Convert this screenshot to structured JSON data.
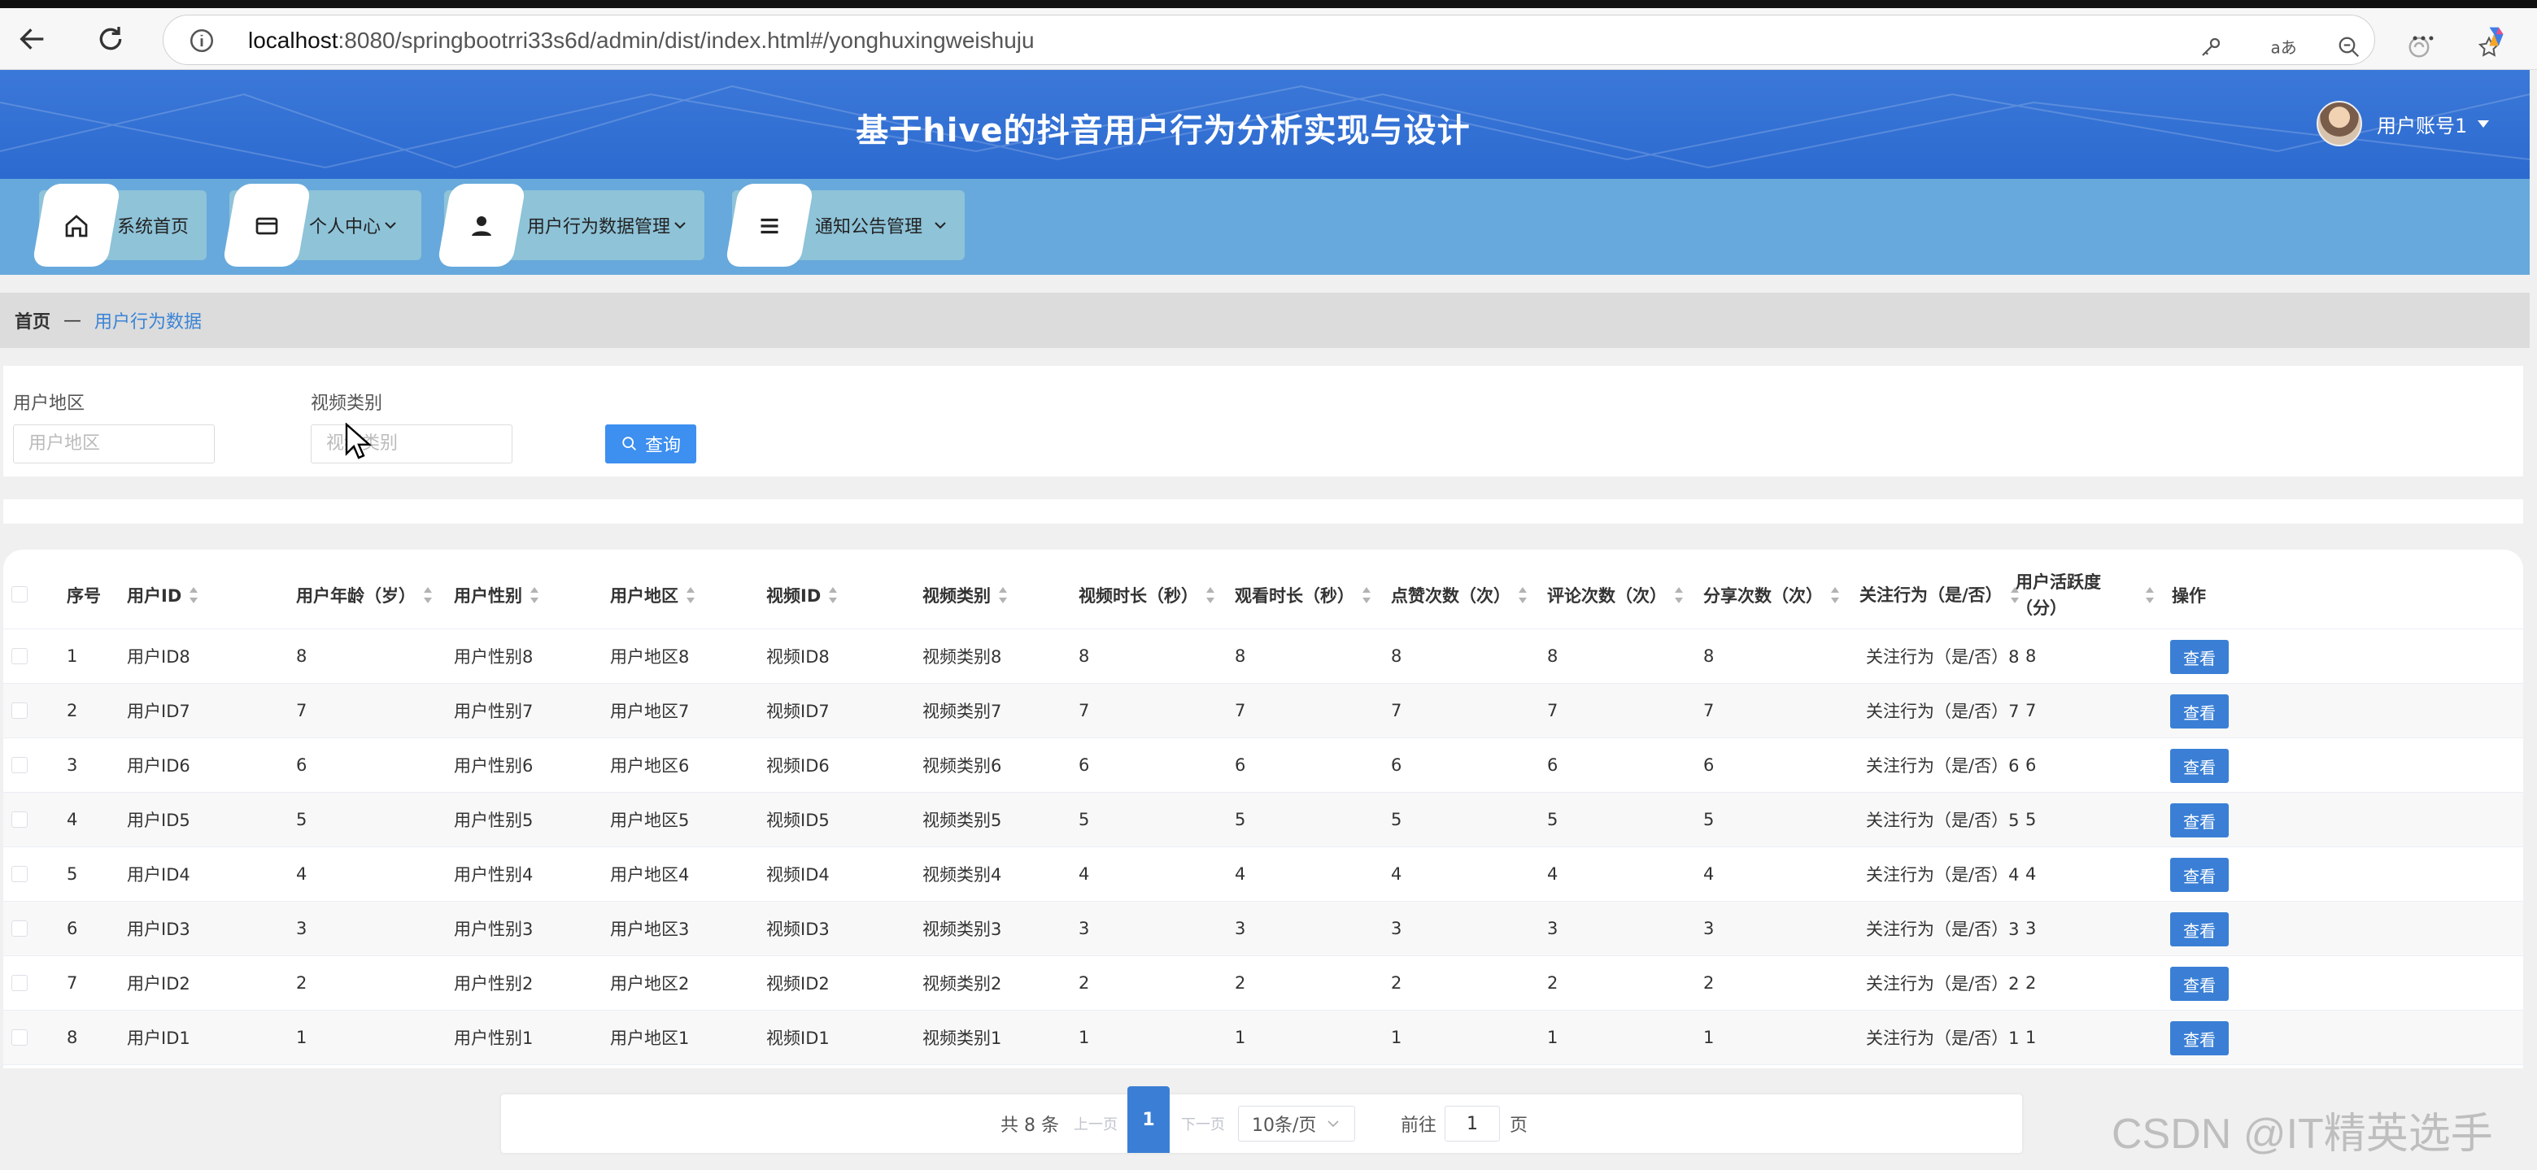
{
  "browser": {
    "url_host": "localhost",
    "url_rest": ":8080/springbootrri33s6d/admin/dist/index.html#/yonghuxingweishuju"
  },
  "header": {
    "title": "基于hive的抖音用户行为分析实现与设计",
    "user": "用户账号1"
  },
  "nav": {
    "items": [
      {
        "label": "系统首页"
      },
      {
        "label": "个人中心"
      },
      {
        "label": "用户行为数据管理"
      },
      {
        "label": "通知公告管理"
      }
    ]
  },
  "breadcrumb": {
    "home": "首页",
    "sep": "—",
    "current": "用户行为数据"
  },
  "search": {
    "region_label": "用户地区",
    "region_placeholder": "用户地区",
    "category_label": "视频类别",
    "category_placeholder": "视频类别",
    "button": "查询"
  },
  "table": {
    "columns": [
      "序号",
      "用户ID",
      "用户年龄（岁）",
      "用户性别",
      "用户地区",
      "视频ID",
      "视频类别",
      "视频时长（秒）",
      "观看时长（秒）",
      "点赞次数（次）",
      "评论次数（次）",
      "分享次数（次）",
      "关注行为（是/否）",
      "用户活跃度（分）",
      "操作"
    ],
    "rows": [
      {
        "idx": "1",
        "uid": "用户ID8",
        "age": "8",
        "gender": "用户性别8",
        "region": "用户地区8",
        "vid": "视频ID8",
        "vcat": "视频类别8",
        "vdur": "8",
        "wdur": "8",
        "likes": "8",
        "comments": "8",
        "shares": "8",
        "follow": "关注行为（是/否）8",
        "active": "8",
        "action": "查看"
      },
      {
        "idx": "2",
        "uid": "用户ID7",
        "age": "7",
        "gender": "用户性别7",
        "region": "用户地区7",
        "vid": "视频ID7",
        "vcat": "视频类别7",
        "vdur": "7",
        "wdur": "7",
        "likes": "7",
        "comments": "7",
        "shares": "7",
        "follow": "关注行为（是/否）7",
        "active": "7",
        "action": "查看"
      },
      {
        "idx": "3",
        "uid": "用户ID6",
        "age": "6",
        "gender": "用户性别6",
        "region": "用户地区6",
        "vid": "视频ID6",
        "vcat": "视频类别6",
        "vdur": "6",
        "wdur": "6",
        "likes": "6",
        "comments": "6",
        "shares": "6",
        "follow": "关注行为（是/否）6",
        "active": "6",
        "action": "查看"
      },
      {
        "idx": "4",
        "uid": "用户ID5",
        "age": "5",
        "gender": "用户性别5",
        "region": "用户地区5",
        "vid": "视频ID5",
        "vcat": "视频类别5",
        "vdur": "5",
        "wdur": "5",
        "likes": "5",
        "comments": "5",
        "shares": "5",
        "follow": "关注行为（是/否）5",
        "active": "5",
        "action": "查看"
      },
      {
        "idx": "5",
        "uid": "用户ID4",
        "age": "4",
        "gender": "用户性别4",
        "region": "用户地区4",
        "vid": "视频ID4",
        "vcat": "视频类别4",
        "vdur": "4",
        "wdur": "4",
        "likes": "4",
        "comments": "4",
        "shares": "4",
        "follow": "关注行为（是/否）4",
        "active": "4",
        "action": "查看"
      },
      {
        "idx": "6",
        "uid": "用户ID3",
        "age": "3",
        "gender": "用户性别3",
        "region": "用户地区3",
        "vid": "视频ID3",
        "vcat": "视频类别3",
        "vdur": "3",
        "wdur": "3",
        "likes": "3",
        "comments": "3",
        "shares": "3",
        "follow": "关注行为（是/否）3",
        "active": "3",
        "action": "查看"
      },
      {
        "idx": "7",
        "uid": "用户ID2",
        "age": "2",
        "gender": "用户性别2",
        "region": "用户地区2",
        "vid": "视频ID2",
        "vcat": "视频类别2",
        "vdur": "2",
        "wdur": "2",
        "likes": "2",
        "comments": "2",
        "shares": "2",
        "follow": "关注行为（是/否）2",
        "active": "2",
        "action": "查看"
      },
      {
        "idx": "8",
        "uid": "用户ID1",
        "age": "1",
        "gender": "用户性别1",
        "region": "用户地区1",
        "vid": "视频ID1",
        "vcat": "视频类别1",
        "vdur": "1",
        "wdur": "1",
        "likes": "1",
        "comments": "1",
        "shares": "1",
        "follow": "关注行为（是/否）1",
        "active": "1",
        "action": "查看"
      }
    ]
  },
  "pager": {
    "total": "共 8 条",
    "prev": "上一页",
    "page": "1",
    "next": "下一页",
    "size": "10条/页",
    "goto": "前往",
    "goto_value": "1",
    "page_unit": "页"
  },
  "watermark": "CSDN @IT精英选手"
}
